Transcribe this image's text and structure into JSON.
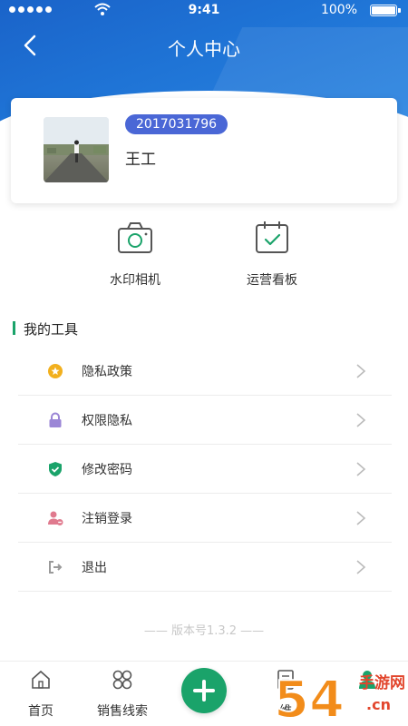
{
  "status_bar": {
    "time": "9:41",
    "battery": "100%"
  },
  "header": {
    "title": "个人中心"
  },
  "profile": {
    "id": "2017031796",
    "name": "王工"
  },
  "quick_actions": [
    {
      "label": "水印相机",
      "icon": "camera-icon"
    },
    {
      "label": "运营看板",
      "icon": "calendar-check-icon"
    }
  ],
  "tools": {
    "title": "我的工具",
    "items": [
      {
        "label": "隐私政策",
        "icon": "privacy-star-icon",
        "color": "#f2b01e"
      },
      {
        "label": "权限隐私",
        "icon": "lock-icon",
        "color": "#9b86d6"
      },
      {
        "label": "修改密码",
        "icon": "shield-check-icon",
        "color": "#1aa36a"
      },
      {
        "label": "注销登录",
        "icon": "user-remove-icon",
        "color": "#e07a8e"
      },
      {
        "label": "退出",
        "icon": "exit-icon",
        "color": "#9a9a9a"
      }
    ]
  },
  "version": "—— 版本号1.3.2 ——",
  "tabbar": {
    "items": [
      {
        "label": "首页",
        "icon": "home-icon"
      },
      {
        "label": "销售线索",
        "icon": "grid-icon"
      },
      {
        "label": "维",
        "icon": "document-icon"
      }
    ],
    "fab_icon": "plus-icon",
    "profile_icon": "person-icon"
  },
  "watermark": {
    "text": "54",
    "site": "手游网",
    "domain": ".cn"
  },
  "colors": {
    "primary": "#1f74d6",
    "accent": "#1aa36a",
    "badge": "#4a67d6"
  }
}
